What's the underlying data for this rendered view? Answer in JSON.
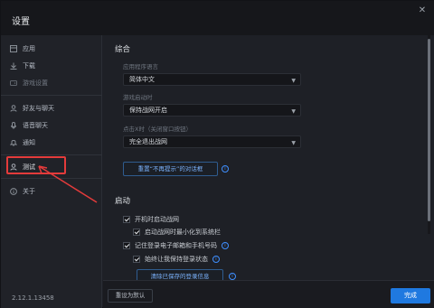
{
  "window": {
    "title": "设置"
  },
  "sidebar": {
    "items": [
      {
        "label": "应用",
        "icon": "app-grid-icon"
      },
      {
        "label": "下载",
        "icon": "download-icon"
      },
      {
        "label": "游戏设置",
        "icon": "game-settings-icon"
      },
      {
        "label": "好友与聊天",
        "icon": "friends-icon"
      },
      {
        "label": "语音聊天",
        "icon": "microphone-icon"
      },
      {
        "label": "通知",
        "icon": "notification-icon"
      },
      {
        "label": "测试",
        "icon": "test-user-icon"
      },
      {
        "label": "关于",
        "icon": "info-circle-icon"
      }
    ],
    "version": "2.12.1.13458"
  },
  "main": {
    "general": {
      "title": "综合",
      "language_label": "应用程序语言",
      "language_value": "简体中文",
      "startup_label": "游戏启动时",
      "startup_value": "保持战网开启",
      "close_label": "点击X时（关闭窗口按钮）",
      "close_value": "完全退出战网",
      "reset_tips_button": "重置“不再提示”的对话框"
    },
    "launch": {
      "title": "启动",
      "auto_launch": "开机时启动战网",
      "minimize_tray": "启动战网时最小化到系统栏",
      "remember_login": "记住登录电子邮箱和手机号码",
      "stay_logged_in": "始终让我保持登录状态",
      "clear_login_button": "清除已保存的登录信息"
    }
  },
  "footer": {
    "reset_default": "重设为默认",
    "done": "完成"
  },
  "colors": {
    "accent": "#1f79e0",
    "highlight_annotation": "#e43b3b",
    "link": "#7cb4ff"
  }
}
